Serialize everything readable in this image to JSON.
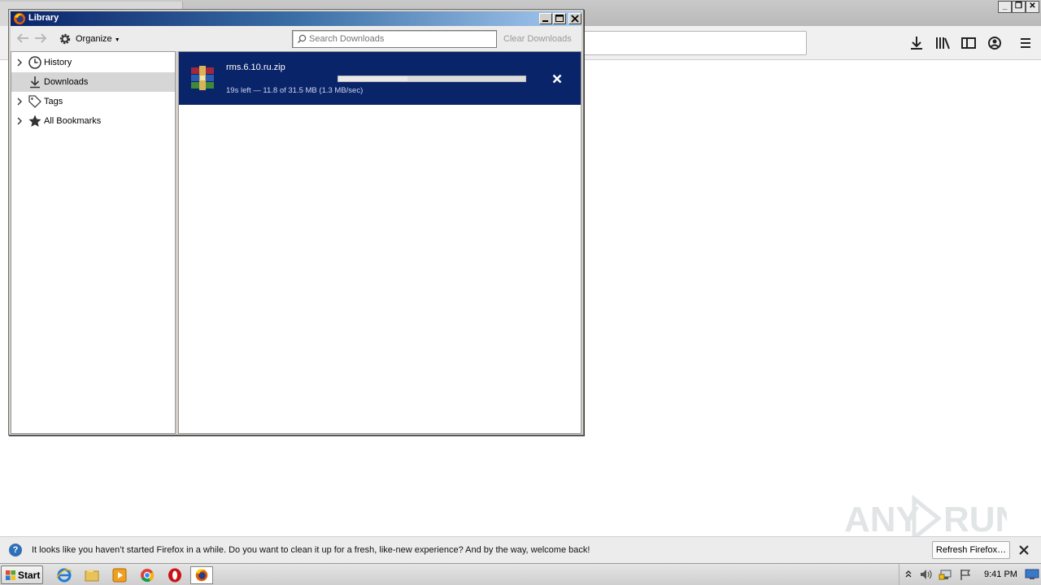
{
  "library_window": {
    "title": "Library",
    "toolbar": {
      "organize_label": "Organize",
      "search_placeholder": "Search Downloads",
      "clear_downloads_label": "Clear Downloads"
    },
    "sidebar": {
      "items": [
        {
          "label": "History",
          "icon": "clock-icon"
        },
        {
          "label": "Downloads",
          "icon": "download-icon",
          "selected": true
        },
        {
          "label": "Tags",
          "icon": "tag-icon"
        },
        {
          "label": "All Bookmarks",
          "icon": "star-icon"
        }
      ]
    },
    "downloads": [
      {
        "filename": "rms.6.10.ru.zip",
        "status": "19s left — 11.8 of 31.5 MB (1.3 MB/sec)",
        "progress_fraction": 0.37
      }
    ]
  },
  "notification_bar": {
    "message": "It looks like you haven’t started Firefox in a while. Do you want to clean it up for a fresh, like-new experience? And by the way, welcome back!",
    "button_label": "Refresh Firefox…"
  },
  "taskbar": {
    "start_label": "Start",
    "clock": "9:41 PM"
  },
  "colors": {
    "selection_blue": "#0a246a",
    "title_gradient_start": "#0a246a",
    "title_gradient_end": "#a6caf0"
  }
}
